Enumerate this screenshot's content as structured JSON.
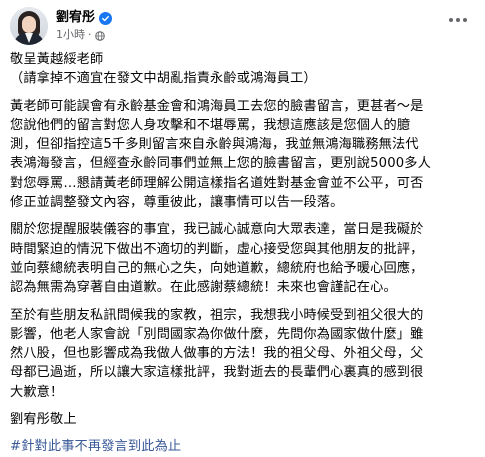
{
  "author": {
    "name": "劉宥彤",
    "timestamp": "1小時",
    "separator": "·"
  },
  "post": {
    "salutation": "敬呈黃越綏老師",
    "subtitle": "（請拿掉不適宜在發文中胡亂指責永齡或鴻海員工）",
    "paragraph1": "黃老師可能誤會有永齡基金會和鴻海員工去您的臉書留言，更甚者～是\n您說他們的留言對您人身攻擊和不堪辱罵，我想這應該是您個人的臆\n測，但卻指控這5千多則留言來自永齡與鴻海，我並無鴻海職務無法代\n表鴻海發言，但經查永齡同事們並無上您的臉書留言，更別說5000多人\n對您辱罵…懇請黃老師理解公開這樣指名道姓對基金會並不公平，可否\n修正並調整發文內容，尊重彼此，讓事情可以告一段落。",
    "paragraph2": "關於您提醒服裝儀容的事宜，我已誠心誠意向大眾表達，當日是我礙於\n時間緊迫的情況下做出不適切的判斷，虛心接受您與其他朋友的批評，\n並向蔡總統表明自己的無心之失，向她道歉，總統府也給予暖心回應，\n認為無需為穿著自由道歉。在此感謝蔡總統！未來也會謹記在心。",
    "paragraph3": "至於有些朋友私訊問候我的家教，祖宗，我想我小時候受到祖父很大的\n影響，他老人家會說「別問國家為你做什麼，先問你為國家做什麼」雖\n然八股，但也影響成為我做人做事的方法！我的祖父母、外祖父母，父\n母都已過逝，所以讓大家這樣批評，我對逝去的長輩們心裏真的感到很\n大歉意！",
    "signature": "劉宥彤敬上",
    "hashtag": "#針對此事不再發言到此為止"
  },
  "colors": {
    "verified": "#1877f2",
    "hashtag": "#385898",
    "secondary_text": "#65676b"
  },
  "icons": {
    "verified": "verified-badge-icon",
    "privacy": "globe-icon",
    "more": "more-options-icon"
  }
}
